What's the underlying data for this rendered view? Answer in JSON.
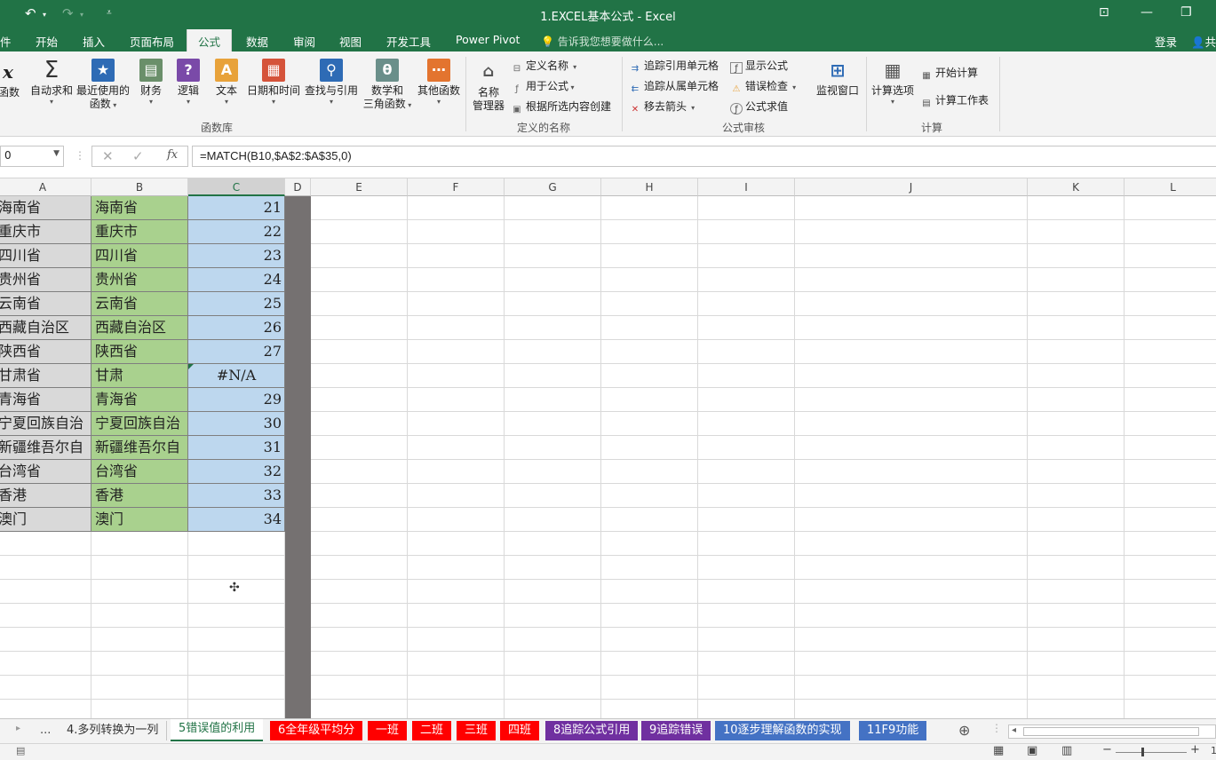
{
  "window": {
    "title": "1.EXCEL基本公式 - Excel",
    "login": "登录",
    "share": "共"
  },
  "ribbon_tabs": [
    {
      "label": "件"
    },
    {
      "label": "开始"
    },
    {
      "label": "插入"
    },
    {
      "label": "页面布局"
    },
    {
      "label": "公式",
      "active": true
    },
    {
      "label": "数据"
    },
    {
      "label": "审阅"
    },
    {
      "label": "视图"
    },
    {
      "label": "开发工具"
    },
    {
      "label": "Power Pivot"
    }
  ],
  "tell_me": "告诉我您想要做什么...",
  "ribbon": {
    "insert_fn": "函数",
    "function_library": {
      "label": "函数库",
      "buttons": [
        {
          "line1": "自动求和",
          "line2": ""
        },
        {
          "line1": "最近使用的",
          "line2": "函数"
        },
        {
          "line1": "财务",
          "line2": ""
        },
        {
          "line1": "逻辑",
          "line2": ""
        },
        {
          "line1": "文本",
          "line2": ""
        },
        {
          "line1": "日期和时间",
          "line2": ""
        },
        {
          "line1": "查找与引用",
          "line2": ""
        },
        {
          "line1": "数学和",
          "line2": "三角函数"
        },
        {
          "line1": "其他函数",
          "line2": ""
        }
      ]
    },
    "defined_names": {
      "label": "定义的名称",
      "manager_line1": "名称",
      "manager_line2": "管理器",
      "items": [
        "定义名称",
        "用于公式",
        "根据所选内容创建"
      ]
    },
    "formula_auditing": {
      "label": "公式审核",
      "items": [
        "追踪引用单元格",
        "追踪从属单元格",
        "移去箭头",
        "显示公式",
        "错误检查",
        "公式求值"
      ],
      "watch": "监视窗口"
    },
    "calculation": {
      "label": "计算",
      "options": "计算选项",
      "calc_now": "开始计算",
      "calc_sheet": "计算工作表"
    }
  },
  "formula_bar": {
    "name_box": "0",
    "formula": "=MATCH(B10,$A$2:$A$35,0)"
  },
  "columns": [
    "A",
    "B",
    "C",
    "D",
    "E",
    "F",
    "G",
    "H",
    "I",
    "J",
    "K",
    "L"
  ],
  "rows": [
    {
      "a": "海南省",
      "b": "海南省",
      "c": "21"
    },
    {
      "a": "重庆市",
      "b": "重庆市",
      "c": "22"
    },
    {
      "a": "四川省",
      "b": "四川省",
      "c": "23"
    },
    {
      "a": "贵州省",
      "b": "贵州省",
      "c": "24"
    },
    {
      "a": "云南省",
      "b": "云南省",
      "c": "25"
    },
    {
      "a": "西藏自治区",
      "b": "西藏自治区",
      "c": "26"
    },
    {
      "a": "陕西省",
      "b": "陕西省",
      "c": "27"
    },
    {
      "a": "甘肃省",
      "b": "甘肃",
      "c": "#N/A"
    },
    {
      "a": "青海省",
      "b": "青海省",
      "c": "29"
    },
    {
      "a": "宁夏回族自治",
      "b": "宁夏回族自治",
      "c": "30"
    },
    {
      "a": "新疆维吾尔自",
      "b": "新疆维吾尔自",
      "c": "31"
    },
    {
      "a": "台湾省",
      "b": "台湾省",
      "c": "32"
    },
    {
      "a": "香港",
      "b": "香港",
      "c": "33"
    },
    {
      "a": "澳门",
      "b": "澳门",
      "c": "34"
    }
  ],
  "sheet_tabs": [
    {
      "label": "...",
      "color": "#f3f3f3",
      "text": "#444"
    },
    {
      "label": "4.多列转换为一列",
      "color": "#f3f3f3",
      "text": "#333"
    },
    {
      "label": "5错误值的利用",
      "color": "#ffffff",
      "text": "#217346",
      "active": true
    },
    {
      "label": "6全年级平均分",
      "color": "#ff0000",
      "text": "#ffffff"
    },
    {
      "label": "一班",
      "color": "#ff0000",
      "text": "#ffffff"
    },
    {
      "label": "二班",
      "color": "#ff0000",
      "text": "#ffffff"
    },
    {
      "label": "三班",
      "color": "#ff0000",
      "text": "#ffffff"
    },
    {
      "label": "四班",
      "color": "#ff0000",
      "text": "#ffffff"
    },
    {
      "label": "8追踪公式引用",
      "color": "#7030a0",
      "text": "#ffffff"
    },
    {
      "label": "9追踪错误",
      "color": "#7030a0",
      "text": "#ffffff"
    },
    {
      "label": "10逐步理解函数的实现",
      "color": "#4472c4",
      "text": "#ffffff"
    },
    {
      "label": "11F9功能",
      "color": "#4472c4",
      "text": "#ffffff"
    }
  ],
  "status": {
    "zoom_tail": "1"
  },
  "colors": {
    "accent": "#217346",
    "green_cell": "#a9d18e",
    "blue_cell": "#bdd7ee",
    "grey_cell": "#d9d9d9"
  }
}
